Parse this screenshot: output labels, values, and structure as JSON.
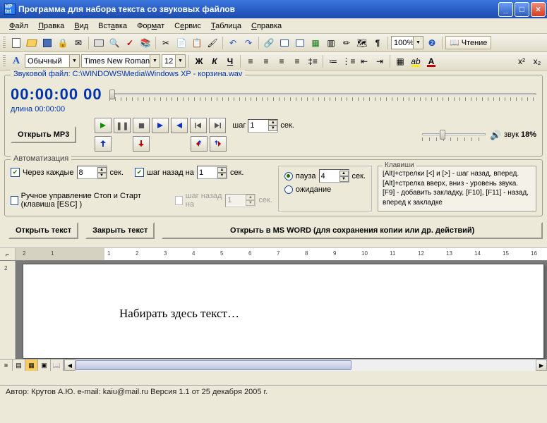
{
  "window": {
    "title": "Программа для набора текста со звуковых файлов",
    "icon_text": "MP txt"
  },
  "menu": {
    "file": "Файл",
    "edit": "Правка",
    "view": "Вид",
    "insert": "Вставка",
    "format": "Формат",
    "service": "Сервис",
    "table": "Таблица",
    "help": "Справка"
  },
  "toolbar1": {
    "zoom": "100%",
    "reading": "Чтение"
  },
  "toolbar2": {
    "font_style_icon": "A",
    "style": "Обычный",
    "font": "Times New Roman",
    "size": "12",
    "bold": "Ж",
    "italic": "К",
    "underline": "Ч"
  },
  "sound": {
    "legend": "Звуковой файл: C:\\WINDOWS\\Media\\Windows XP - корзина.wav",
    "timecode": "00:00:00 00",
    "duration_label": "длина",
    "duration_value": "00:00:00",
    "open_mp3": "Открыть MP3",
    "step_label": "шаг",
    "step_value": "1",
    "sec": "сек.",
    "volume_label": "звук",
    "volume_value": "18%"
  },
  "auto": {
    "legend": "Автоматизация",
    "every_label": "Через каждые",
    "every_value": "8",
    "sec": "сек.",
    "stepback_label": "шаг назад на",
    "stepback_value": "1",
    "pause_label": "пауза",
    "pause_value": "4",
    "wait_label": "ожидание",
    "manual_label": "Ручное управление Стоп и Старт (клавиша [ESC] )",
    "stepback2_label": "шаг назад на",
    "stepback2_value": "1",
    "keys_legend": "Клавиши",
    "keys_text1": "[Alt]+стрелки [<] и [>]  - шаг назад, вперед.",
    "keys_text2": "[Alt]+стрелка вверх, вниз - уровень звука.",
    "keys_text3": "[F9] - добавить закладку, [F10], [F11] - назад, вперед к закладке"
  },
  "buttons": {
    "open_text": "Открыть текст",
    "close_text": "Закрыть текст",
    "open_word": "Открыть в MS WORD (для сохранения копии или др. действий)"
  },
  "doc": {
    "placeholder": "Набирать здесь текст…"
  },
  "ruler": {
    "nums": [
      "2",
      "1",
      "",
      "1",
      "2",
      "3",
      "4",
      "5",
      "6",
      "7",
      "8",
      "9",
      "10",
      "11",
      "12",
      "13",
      "14",
      "15",
      "16"
    ]
  },
  "status": {
    "text": "Автор: Крутов А.Ю.  e-mail: kaiu@mail.ru  Версия 1.1 от 25 декабря 2005 г."
  }
}
